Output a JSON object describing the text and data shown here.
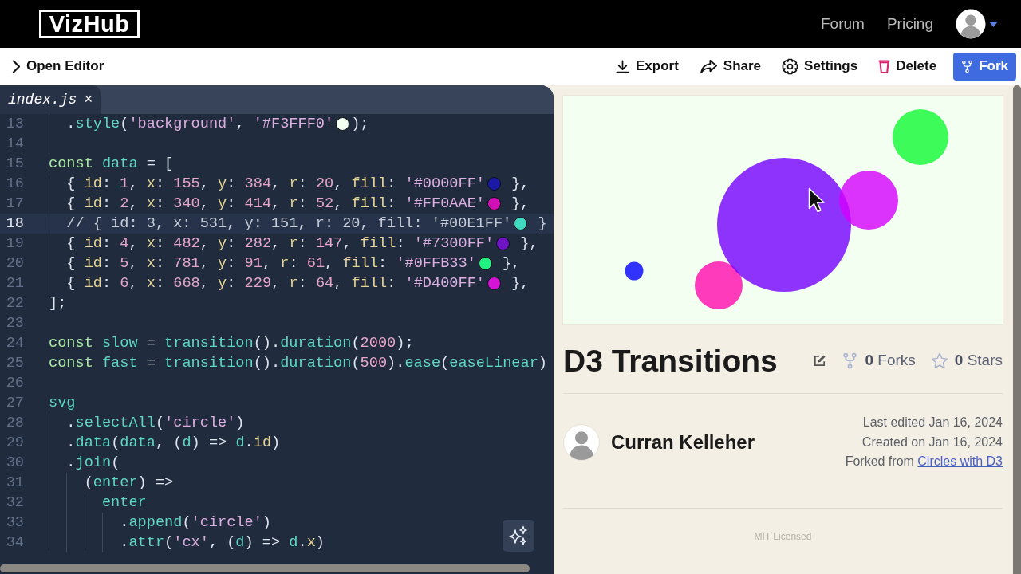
{
  "navbar": {
    "logo": "VizHub",
    "links": [
      "Forum",
      "Pricing"
    ]
  },
  "toolbar": {
    "open_editor": "Open Editor",
    "actions": [
      {
        "kind": "export",
        "label": "Export"
      },
      {
        "kind": "share",
        "label": "Share"
      },
      {
        "kind": "settings",
        "label": "Settings"
      },
      {
        "kind": "delete",
        "label": "Delete"
      },
      {
        "kind": "fork",
        "label": "Fork"
      }
    ]
  },
  "editor": {
    "tab": {
      "label": "index.js",
      "close": "×",
      "selected": true
    },
    "lines": [
      {
        "number": "13",
        "active": false,
        "tokens": [
          {
            "kind": "indent"
          },
          {
            "kind": "punct",
            "text": "."
          },
          {
            "kind": "name",
            "text": "style"
          },
          {
            "kind": "punct",
            "text": "("
          },
          {
            "kind": "string",
            "text": "'background'"
          },
          {
            "kind": "punct",
            "text": ", "
          },
          {
            "kind": "string",
            "text": "'#F3FFF0'"
          },
          {
            "kind": "swatch",
            "color": "#f3fff0"
          },
          {
            "kind": "punct",
            "text": ");"
          }
        ]
      },
      {
        "number": "14",
        "active": false,
        "tokens": [
          {
            "kind": "indent"
          }
        ]
      },
      {
        "number": "15",
        "active": false,
        "tokens": [
          {
            "kind": "keyword",
            "text": "const "
          },
          {
            "kind": "name",
            "text": "data"
          },
          {
            "kind": "punct",
            "text": " = ["
          }
        ]
      },
      {
        "number": "16",
        "active": false,
        "tokens": [
          {
            "kind": "indent"
          },
          {
            "kind": "punct",
            "text": "{ "
          },
          {
            "kind": "prop",
            "text": "id"
          },
          {
            "kind": "punct",
            "text": ": "
          },
          {
            "kind": "number",
            "text": "1"
          },
          {
            "kind": "punct",
            "text": ", "
          },
          {
            "kind": "prop",
            "text": "x"
          },
          {
            "kind": "punct",
            "text": ": "
          },
          {
            "kind": "number",
            "text": "155"
          },
          {
            "kind": "punct",
            "text": ", "
          },
          {
            "kind": "prop",
            "text": "y"
          },
          {
            "kind": "punct",
            "text": ": "
          },
          {
            "kind": "number",
            "text": "384"
          },
          {
            "kind": "punct",
            "text": ", "
          },
          {
            "kind": "prop",
            "text": "r"
          },
          {
            "kind": "punct",
            "text": ": "
          },
          {
            "kind": "number",
            "text": "20"
          },
          {
            "kind": "punct",
            "text": ", "
          },
          {
            "kind": "prop",
            "text": "fill"
          },
          {
            "kind": "punct",
            "text": ": "
          },
          {
            "kind": "string",
            "text": "'#0000FF'"
          },
          {
            "kind": "swatch",
            "color": "#1a1aa6"
          },
          {
            "kind": "punct",
            "text": " },"
          }
        ]
      },
      {
        "number": "17",
        "active": false,
        "tokens": [
          {
            "kind": "indent"
          },
          {
            "kind": "punct",
            "text": "{ "
          },
          {
            "kind": "prop",
            "text": "id"
          },
          {
            "kind": "punct",
            "text": ": "
          },
          {
            "kind": "number",
            "text": "2"
          },
          {
            "kind": "punct",
            "text": ", "
          },
          {
            "kind": "prop",
            "text": "x"
          },
          {
            "kind": "punct",
            "text": ": "
          },
          {
            "kind": "number",
            "text": "340"
          },
          {
            "kind": "punct",
            "text": ", "
          },
          {
            "kind": "prop",
            "text": "y"
          },
          {
            "kind": "punct",
            "text": ": "
          },
          {
            "kind": "number",
            "text": "414"
          },
          {
            "kind": "punct",
            "text": ", "
          },
          {
            "kind": "prop",
            "text": "r"
          },
          {
            "kind": "punct",
            "text": ": "
          },
          {
            "kind": "number",
            "text": "52"
          },
          {
            "kind": "punct",
            "text": ", "
          },
          {
            "kind": "prop",
            "text": "fill"
          },
          {
            "kind": "punct",
            "text": ": "
          },
          {
            "kind": "string",
            "text": "'#FF0AAE'"
          },
          {
            "kind": "swatch",
            "color": "#d20fb4"
          },
          {
            "kind": "punct",
            "text": " },"
          }
        ]
      },
      {
        "number": "18",
        "active": true,
        "tokens": [
          {
            "kind": "indent"
          },
          {
            "kind": "comment",
            "text": "// { id: 3, x: 531, y: 151, r: 20, fill: '#00E1FF'"
          },
          {
            "kind": "swatch",
            "color": "#3fd8c0"
          },
          {
            "kind": "comment",
            "text": " }"
          }
        ]
      },
      {
        "number": "19",
        "active": false,
        "tokens": [
          {
            "kind": "indent"
          },
          {
            "kind": "punct",
            "text": "{ "
          },
          {
            "kind": "prop",
            "text": "id"
          },
          {
            "kind": "punct",
            "text": ": "
          },
          {
            "kind": "number",
            "text": "4"
          },
          {
            "kind": "punct",
            "text": ", "
          },
          {
            "kind": "prop",
            "text": "x"
          },
          {
            "kind": "punct",
            "text": ": "
          },
          {
            "kind": "number",
            "text": "482"
          },
          {
            "kind": "punct",
            "text": ", "
          },
          {
            "kind": "prop",
            "text": "y"
          },
          {
            "kind": "punct",
            "text": ": "
          },
          {
            "kind": "number",
            "text": "282"
          },
          {
            "kind": "punct",
            "text": ", "
          },
          {
            "kind": "prop",
            "text": "r"
          },
          {
            "kind": "punct",
            "text": ": "
          },
          {
            "kind": "number",
            "text": "147"
          },
          {
            "kind": "punct",
            "text": ", "
          },
          {
            "kind": "prop",
            "text": "fill"
          },
          {
            "kind": "punct",
            "text": ": "
          },
          {
            "kind": "string",
            "text": "'#7300FF'"
          },
          {
            "kind": "swatch",
            "color": "#6f14c4"
          },
          {
            "kind": "punct",
            "text": " },"
          }
        ]
      },
      {
        "number": "20",
        "active": false,
        "tokens": [
          {
            "kind": "indent"
          },
          {
            "kind": "punct",
            "text": "{ "
          },
          {
            "kind": "prop",
            "text": "id"
          },
          {
            "kind": "punct",
            "text": ": "
          },
          {
            "kind": "number",
            "text": "5"
          },
          {
            "kind": "punct",
            "text": ", "
          },
          {
            "kind": "prop",
            "text": "x"
          },
          {
            "kind": "punct",
            "text": ": "
          },
          {
            "kind": "number",
            "text": "781"
          },
          {
            "kind": "punct",
            "text": ", "
          },
          {
            "kind": "prop",
            "text": "y"
          },
          {
            "kind": "punct",
            "text": ": "
          },
          {
            "kind": "number",
            "text": "91"
          },
          {
            "kind": "punct",
            "text": ", "
          },
          {
            "kind": "prop",
            "text": "r"
          },
          {
            "kind": "punct",
            "text": ": "
          },
          {
            "kind": "number",
            "text": "61"
          },
          {
            "kind": "punct",
            "text": ", "
          },
          {
            "kind": "prop",
            "text": "fill"
          },
          {
            "kind": "punct",
            "text": ": "
          },
          {
            "kind": "string",
            "text": "'#0FFB33'"
          },
          {
            "kind": "swatch",
            "color": "#22f080"
          },
          {
            "kind": "punct",
            "text": " },"
          }
        ]
      },
      {
        "number": "21",
        "active": false,
        "tokens": [
          {
            "kind": "indent"
          },
          {
            "kind": "punct",
            "text": "{ "
          },
          {
            "kind": "prop",
            "text": "id"
          },
          {
            "kind": "punct",
            "text": ": "
          },
          {
            "kind": "number",
            "text": "6"
          },
          {
            "kind": "punct",
            "text": ", "
          },
          {
            "kind": "prop",
            "text": "x"
          },
          {
            "kind": "punct",
            "text": ": "
          },
          {
            "kind": "number",
            "text": "668"
          },
          {
            "kind": "punct",
            "text": ", "
          },
          {
            "kind": "prop",
            "text": "y"
          },
          {
            "kind": "punct",
            "text": ": "
          },
          {
            "kind": "number",
            "text": "229"
          },
          {
            "kind": "punct",
            "text": ", "
          },
          {
            "kind": "prop",
            "text": "r"
          },
          {
            "kind": "punct",
            "text": ": "
          },
          {
            "kind": "number",
            "text": "64"
          },
          {
            "kind": "punct",
            "text": ", "
          },
          {
            "kind": "prop",
            "text": "fill"
          },
          {
            "kind": "punct",
            "text": ": "
          },
          {
            "kind": "string",
            "text": "'#D400FF'"
          },
          {
            "kind": "swatch",
            "color": "#d414d4"
          },
          {
            "kind": "punct",
            "text": " },"
          }
        ]
      },
      {
        "number": "22",
        "active": false,
        "tokens": [
          {
            "kind": "punct",
            "text": "];"
          }
        ]
      },
      {
        "number": "23",
        "active": false
      },
      {
        "number": "24",
        "active": false,
        "tokens": [
          {
            "kind": "keyword",
            "text": "const "
          },
          {
            "kind": "name",
            "text": "slow"
          },
          {
            "kind": "punct",
            "text": " = "
          },
          {
            "kind": "name",
            "text": "transition"
          },
          {
            "kind": "punct",
            "text": "()."
          },
          {
            "kind": "name",
            "text": "duration"
          },
          {
            "kind": "punct",
            "text": "("
          },
          {
            "kind": "number",
            "text": "2000"
          },
          {
            "kind": "punct",
            "text": ");"
          }
        ]
      },
      {
        "number": "25",
        "active": false,
        "tokens": [
          {
            "kind": "keyword",
            "text": "const "
          },
          {
            "kind": "name",
            "text": "fast"
          },
          {
            "kind": "punct",
            "text": " = "
          },
          {
            "kind": "name",
            "text": "transition"
          },
          {
            "kind": "punct",
            "text": "()."
          },
          {
            "kind": "name",
            "text": "duration"
          },
          {
            "kind": "punct",
            "text": "("
          },
          {
            "kind": "number",
            "text": "500"
          },
          {
            "kind": "punct",
            "text": ")."
          },
          {
            "kind": "name",
            "text": "ease"
          },
          {
            "kind": "punct",
            "text": "("
          },
          {
            "kind": "name",
            "text": "easeLinear"
          },
          {
            "kind": "punct",
            "text": ")"
          }
        ]
      },
      {
        "number": "26",
        "active": false
      },
      {
        "number": "27",
        "active": false,
        "tokens": [
          {
            "kind": "name",
            "text": "svg"
          }
        ]
      },
      {
        "number": "28",
        "active": false,
        "tokens": [
          {
            "kind": "indent"
          },
          {
            "kind": "punct",
            "text": "."
          },
          {
            "kind": "name",
            "text": "selectAll"
          },
          {
            "kind": "punct",
            "text": "("
          },
          {
            "kind": "string",
            "text": "'circle'"
          },
          {
            "kind": "punct",
            "text": ")"
          }
        ]
      },
      {
        "number": "29",
        "active": false,
        "tokens": [
          {
            "kind": "indent"
          },
          {
            "kind": "punct",
            "text": "."
          },
          {
            "kind": "name",
            "text": "data"
          },
          {
            "kind": "punct",
            "text": "("
          },
          {
            "kind": "name",
            "text": "data"
          },
          {
            "kind": "punct",
            "text": ", ("
          },
          {
            "kind": "name",
            "text": "d"
          },
          {
            "kind": "punct",
            "text": ") => "
          },
          {
            "kind": "name",
            "text": "d"
          },
          {
            "kind": "punct",
            "text": "."
          },
          {
            "kind": "prop",
            "text": "id"
          },
          {
            "kind": "punct",
            "text": ")"
          }
        ]
      },
      {
        "number": "30",
        "active": false,
        "tokens": [
          {
            "kind": "indent"
          },
          {
            "kind": "punct",
            "text": "."
          },
          {
            "kind": "name",
            "text": "join"
          },
          {
            "kind": "punct",
            "text": "("
          }
        ]
      },
      {
        "number": "31",
        "active": false,
        "tokens": [
          {
            "kind": "indent"
          },
          {
            "kind": "indent"
          },
          {
            "kind": "punct",
            "text": "("
          },
          {
            "kind": "name",
            "text": "enter"
          },
          {
            "kind": "punct",
            "text": ") =>"
          }
        ]
      },
      {
        "number": "32",
        "active": false,
        "tokens": [
          {
            "kind": "indent"
          },
          {
            "kind": "indent"
          },
          {
            "kind": "indent"
          },
          {
            "kind": "name",
            "text": "enter"
          }
        ]
      },
      {
        "number": "33",
        "active": false,
        "tokens": [
          {
            "kind": "indent"
          },
          {
            "kind": "indent"
          },
          {
            "kind": "indent"
          },
          {
            "kind": "indent"
          },
          {
            "kind": "punct",
            "text": "."
          },
          {
            "kind": "name",
            "text": "append"
          },
          {
            "kind": "punct",
            "text": "("
          },
          {
            "kind": "string",
            "text": "'circle'"
          },
          {
            "kind": "punct",
            "text": ")"
          }
        ]
      },
      {
        "number": "34",
        "active": false,
        "tokens": [
          {
            "kind": "indent"
          },
          {
            "kind": "indent"
          },
          {
            "kind": "indent"
          },
          {
            "kind": "indent"
          },
          {
            "kind": "punct",
            "text": "."
          },
          {
            "kind": "name",
            "text": "attr"
          },
          {
            "kind": "punct",
            "text": "("
          },
          {
            "kind": "string",
            "text": "'cx'"
          },
          {
            "kind": "punct",
            "text": ", ("
          },
          {
            "kind": "name",
            "text": "d"
          },
          {
            "kind": "punct",
            "text": ") => "
          },
          {
            "kind": "name",
            "text": "d"
          },
          {
            "kind": "punct",
            "text": "."
          },
          {
            "kind": "prop",
            "text": "x"
          },
          {
            "kind": "punct",
            "text": ")"
          }
        ]
      }
    ]
  },
  "project": {
    "title": "D3 Transitions",
    "forks": "**0** Forks",
    "stars": "**0** Stars",
    "author": "Curran Kelleher",
    "dates": [
      "Last edited Jan 16, 2024",
      "Created on Jan 16, 2024"
    ],
    "forked_from": {
      "label": "Forked from",
      "link": "Circles with D3"
    },
    "license": "MIT Licensed"
  }
}
